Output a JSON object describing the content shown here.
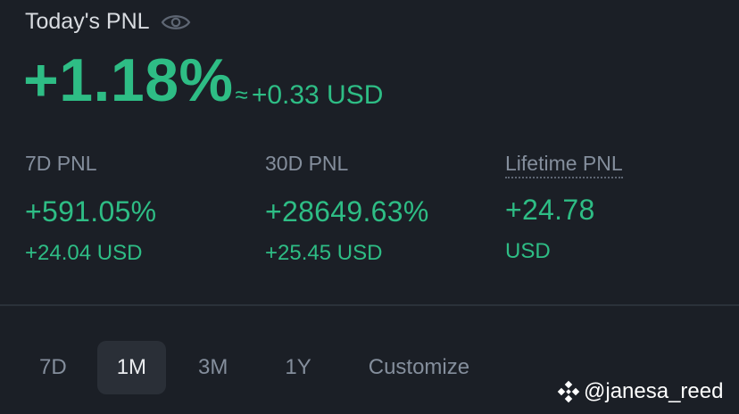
{
  "today": {
    "title": "Today's PNL",
    "percent": "+1.18%",
    "approx_symbol": "≈",
    "usd": "+0.33 USD"
  },
  "stats": [
    {
      "label": "7D PNL",
      "percent": "+591.05%",
      "usd": "+24.04 USD"
    },
    {
      "label": "30D PNL",
      "percent": "+28649.63%",
      "usd": "+25.45 USD"
    },
    {
      "label": "Lifetime PNL",
      "value": "+24.78",
      "unit": "USD"
    }
  ],
  "tabs": [
    {
      "label": "7D",
      "active": false
    },
    {
      "label": "1M",
      "active": true
    },
    {
      "label": "3M",
      "active": false
    },
    {
      "label": "1Y",
      "active": false
    },
    {
      "label": "Customize",
      "active": false
    }
  ],
  "watermark": {
    "handle": "@janesa_reed"
  },
  "colors": {
    "background": "#1b1f26",
    "positive": "#2ebd85",
    "muted": "#848e9c",
    "active_tab_bg": "#2a2f37"
  },
  "icons": {
    "visibility": "eye-icon",
    "watermark_logo": "binance-logo-icon"
  }
}
